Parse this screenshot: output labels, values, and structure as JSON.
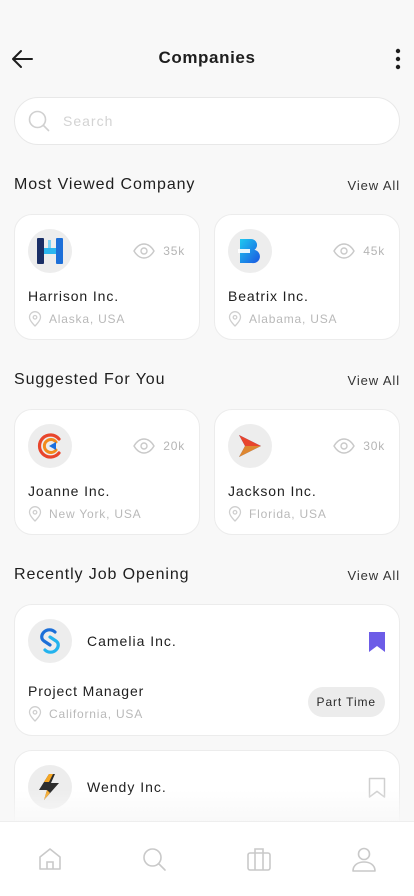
{
  "header": {
    "title": "Companies"
  },
  "search": {
    "placeholder": "Search"
  },
  "sections": {
    "most_viewed": {
      "title": "Most Viewed Company",
      "view_all": "View All"
    },
    "suggested": {
      "title": "Suggested For You",
      "view_all": "View All"
    },
    "recent_jobs": {
      "title": "Recently Job Opening",
      "view_all": "View All"
    }
  },
  "most_viewed": [
    {
      "name": "Harrison Inc.",
      "views": "35k",
      "location": "Alaska, USA"
    },
    {
      "name": "Beatrix Inc.",
      "views": "45k",
      "location": "Alabama, USA"
    }
  ],
  "suggested": [
    {
      "name": "Joanne Inc.",
      "views": "20k",
      "location": "New York, USA"
    },
    {
      "name": "Jackson Inc.",
      "views": "30k",
      "location": "Florida, USA"
    }
  ],
  "jobs": [
    {
      "company": "Camelia Inc.",
      "title": "Project Manager",
      "location": "California, USA",
      "type": "Part Time",
      "bookmarked": true
    },
    {
      "company": "Wendy Inc.",
      "bookmarked": false
    }
  ],
  "colors": {
    "accent": "#6c5ce7",
    "icon_gray": "#c9c9c9",
    "text_light": "#b9b9b9"
  },
  "icons": {
    "back": "arrow-left-icon",
    "more": "more-vertical-icon",
    "search": "search-icon",
    "views": "eye-icon",
    "location": "location-pin-icon",
    "bookmark": "bookmark-icon",
    "tabs": [
      "home-icon",
      "search-icon",
      "briefcase-icon",
      "profile-icon"
    ]
  }
}
